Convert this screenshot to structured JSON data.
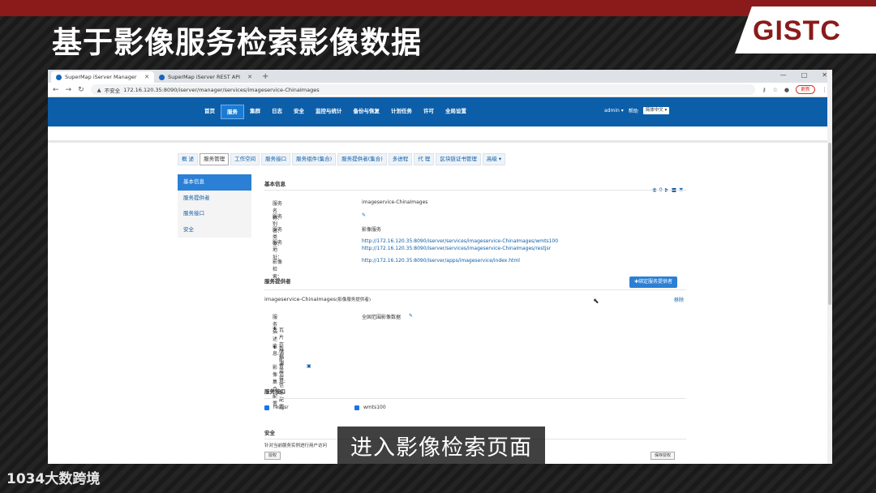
{
  "slide": {
    "title": "基于影像服务检索影像数据",
    "logo": "GISTC",
    "caption": "进入影像检索页面",
    "watermark": "1034大数跨境"
  },
  "browser": {
    "tabs": [
      {
        "label": "SuperMap iServer Manager",
        "active": true
      },
      {
        "label": "SuperMap iServer REST API",
        "active": false
      }
    ],
    "new_tab": "+",
    "security_warning": "不安全",
    "url": "172.16.120.35:8090/iserver/manager/services/imageservice-ChinaImages",
    "update_label": "更新"
  },
  "topnav": {
    "items": [
      "首页",
      "服务",
      "集群",
      "日志",
      "安全",
      "监控与统计",
      "备份与恢复",
      "计划任务",
      "许可",
      "全局设置"
    ],
    "active": "服务",
    "user": "admin ▾",
    "help": "帮助",
    "language": "简体中文 ▾"
  },
  "subtabs": {
    "items": [
      "概 述",
      "服务管理",
      "工作空间",
      "服务接口",
      "服务组件(集合)",
      "服务提供者(集合)",
      "多进程",
      "代 理",
      "区块链证书管理",
      "高级 ▾"
    ],
    "active": "服务管理"
  },
  "sidebar": {
    "items": [
      "基本信息",
      "服务提供者",
      "服务接口",
      "安全"
    ],
    "active": "基本信息"
  },
  "basic_info": {
    "heading": "基本信息",
    "fields": [
      {
        "label": "服务名称：",
        "value": "imageservice-ChinaImages"
      },
      {
        "label": "服务别名：",
        "value": ""
      },
      {
        "label": "服务类型：",
        "value": "影像服务"
      },
      {
        "label": "服务地址：",
        "value": "http://172.16.120.35:8090/iserver/services/imageservice-ChinaImages/wmts100"
      },
      {
        "label": "",
        "value": "http://172.16.120.35:8090/iserver/services/imageservice-ChinaImages/restjsr"
      },
      {
        "label": "影像检索：",
        "value": "http://172.16.120.35:8090/iserver/apps/imageservice/index.html"
      }
    ],
    "counter": "0"
  },
  "provider": {
    "heading": "服务提供者",
    "bind_button": "✚绑定服务提供者",
    "name": "imageservice-ChinaImages",
    "type_note": "(影像服务提供者)",
    "remove": "移除",
    "desc_label": "服务描述信息:",
    "desc_value": "全国范围影像数据",
    "tile_config": "瓦片存储配置信息:",
    "datasource_config": "数据源连接信息配置:",
    "collection_config": "影像集合配置"
  },
  "interfaces": {
    "heading": "服务接口",
    "items": [
      {
        "label": "restjsr",
        "checked": true
      },
      {
        "label": "wmts100",
        "checked": true
      }
    ]
  },
  "security": {
    "heading": "安全",
    "note": "针对当前服务实例进行用户访问",
    "btn_left": "授权",
    "btn_right": "保存授权"
  },
  "colors": {
    "nav_blue": "#0d5ea8",
    "banner_red": "#8b1a1a",
    "active_blue": "#2b7fd4"
  }
}
